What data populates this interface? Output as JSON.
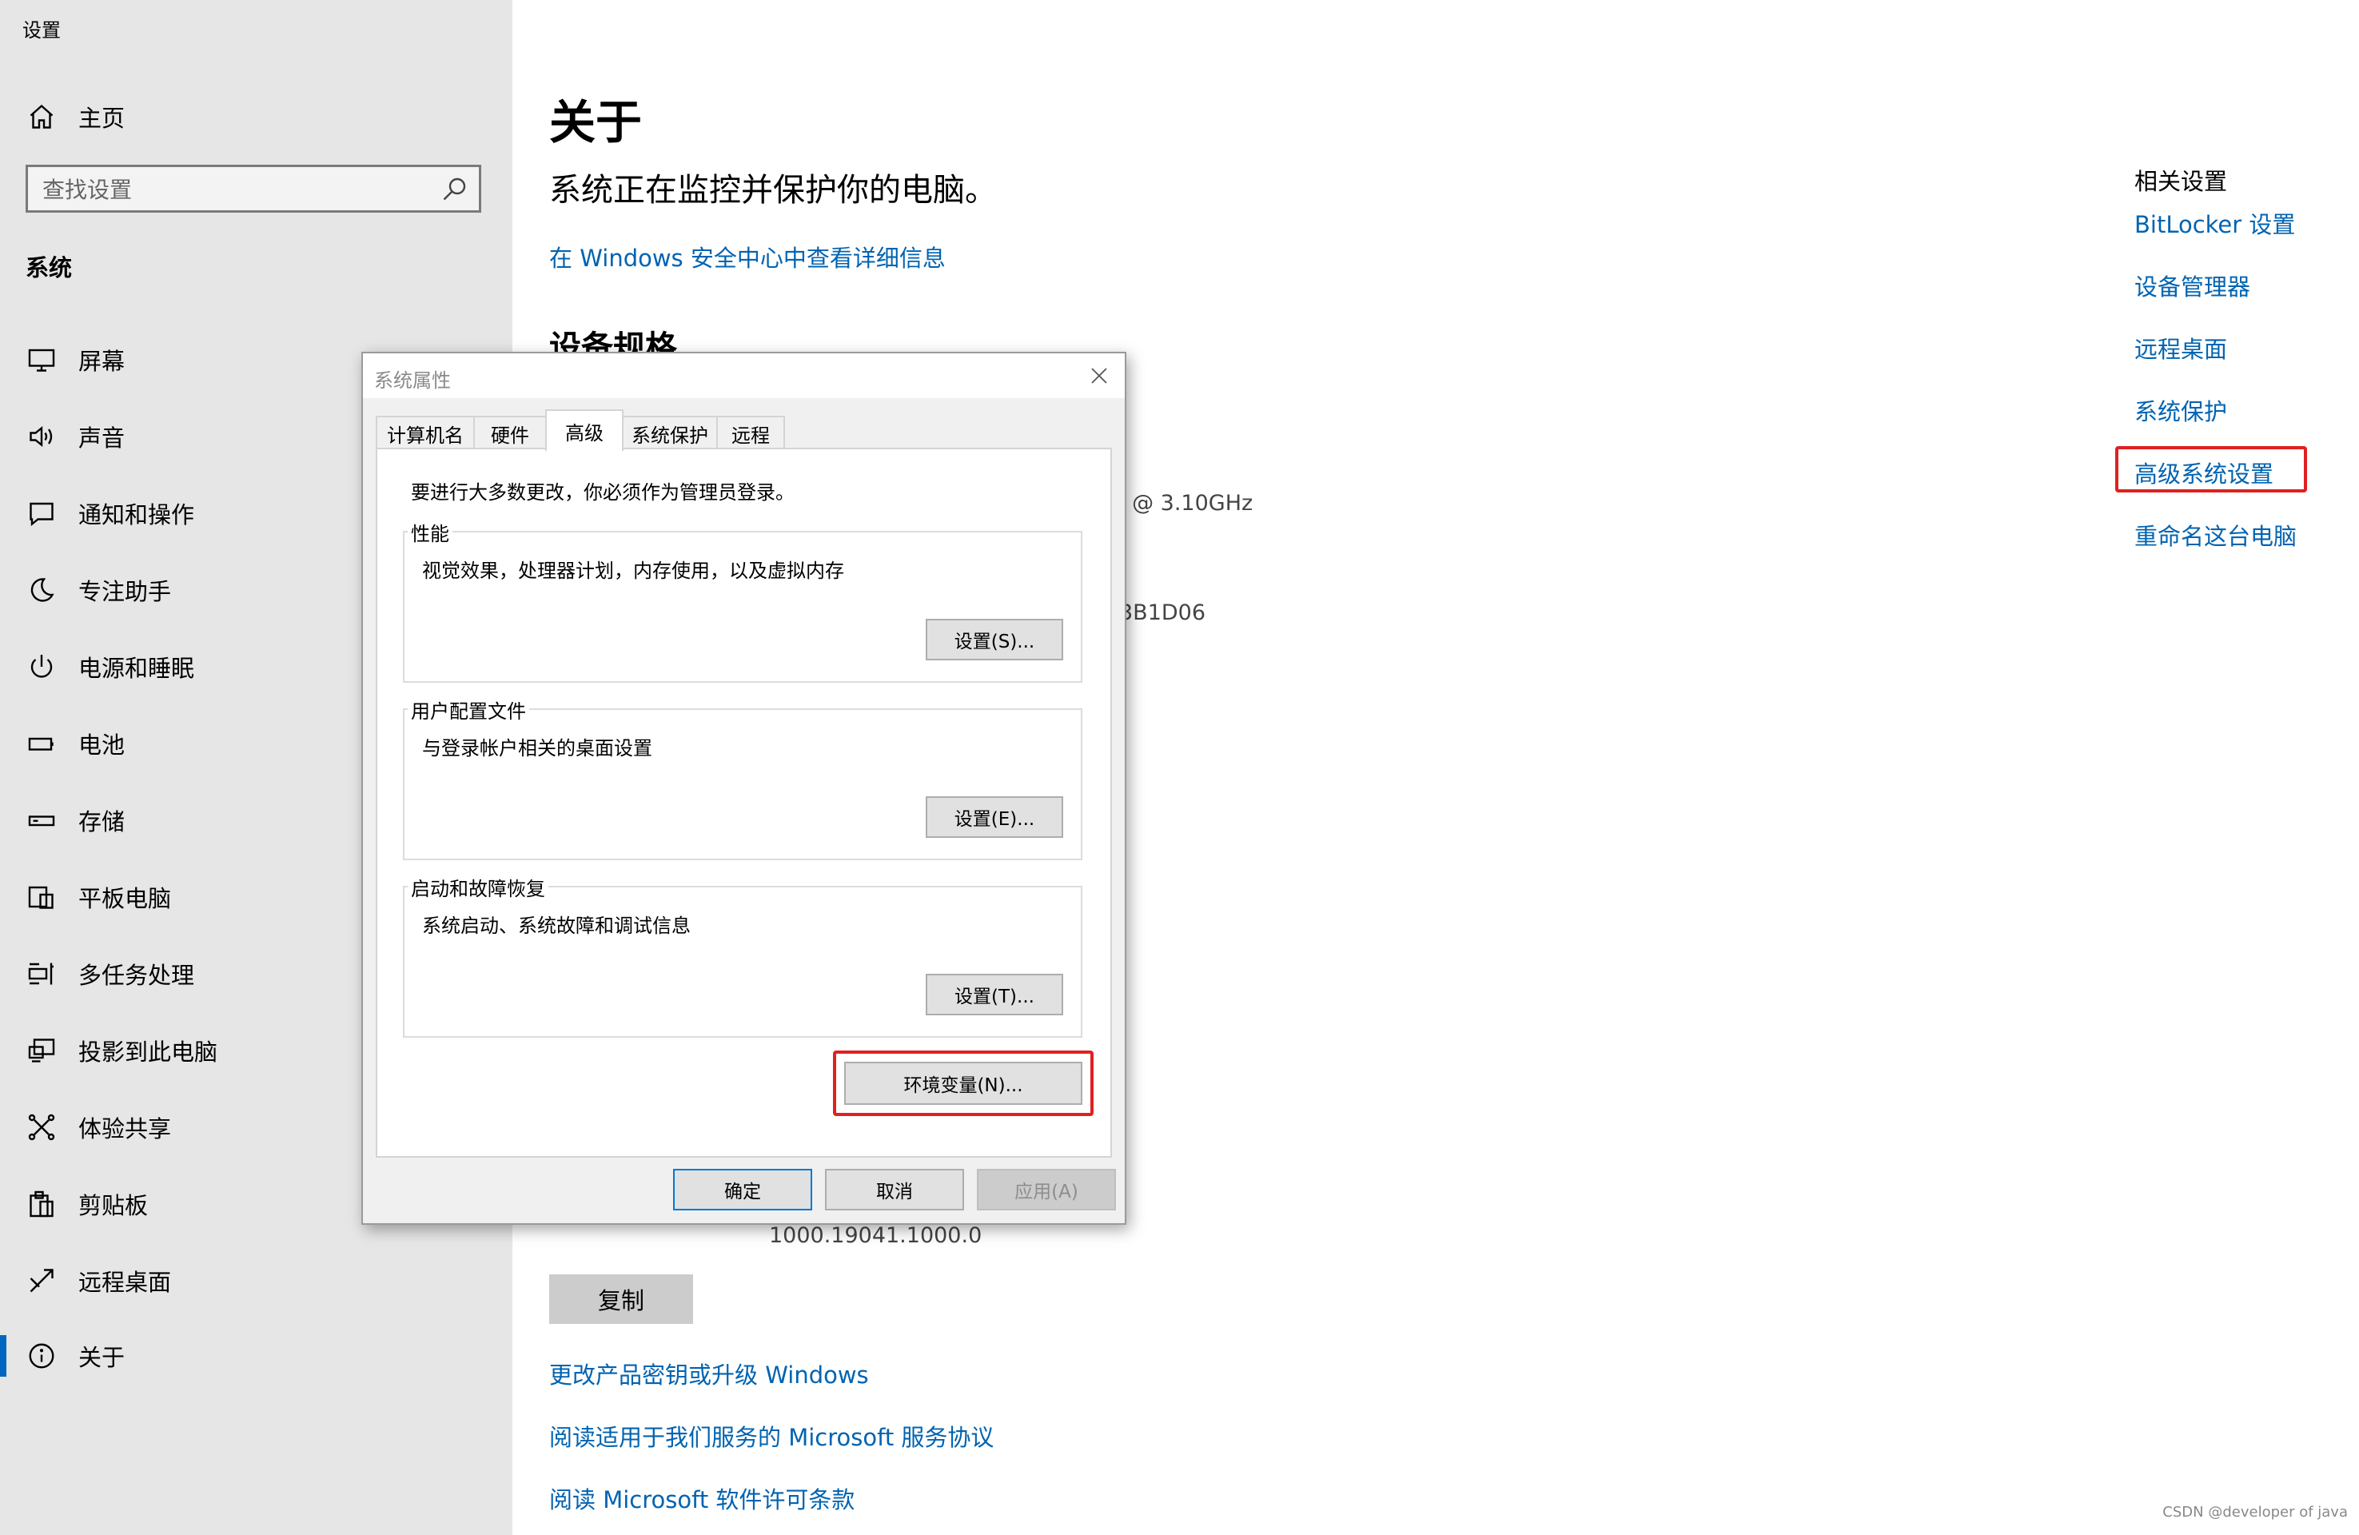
{
  "window": {
    "title": "设置"
  },
  "sidebar": {
    "home_label": "主页",
    "search_placeholder": "查找设置",
    "section_label": "系统",
    "items": [
      {
        "label": "屏幕",
        "icon": "display-icon"
      },
      {
        "label": "声音",
        "icon": "speaker-icon"
      },
      {
        "label": "通知和操作",
        "icon": "notification-icon"
      },
      {
        "label": "专注助手",
        "icon": "moon-icon"
      },
      {
        "label": "电源和睡眠",
        "icon": "power-icon"
      },
      {
        "label": "电池",
        "icon": "battery-icon"
      },
      {
        "label": "存储",
        "icon": "storage-icon"
      },
      {
        "label": "平板电脑",
        "icon": "tablet-icon"
      },
      {
        "label": "多任务处理",
        "icon": "multitask-icon"
      },
      {
        "label": "投影到此电脑",
        "icon": "project-icon"
      },
      {
        "label": "体验共享",
        "icon": "share-icon"
      },
      {
        "label": "剪贴板",
        "icon": "clipboard-icon"
      },
      {
        "label": "远程桌面",
        "icon": "remote-desktop-icon"
      },
      {
        "label": "关于",
        "icon": "info-icon"
      }
    ],
    "selected": "关于"
  },
  "main": {
    "title": "关于",
    "status": "系统正在监控并保护你的电脑。",
    "security_link": "在 Windows 安全中心中查看详细信息",
    "device_specs_title": "设备规格",
    "processor_partial": "l @ 3.10GHz",
    "device_id_partial": "3B1D06",
    "os_build_partial": "1000.19041.1000.0",
    "copy_button": "复制",
    "links": [
      "更改产品密钥或升级 Windows",
      "阅读适用于我们服务的 Microsoft 服务协议",
      "阅读 Microsoft 软件许可条款"
    ]
  },
  "related": {
    "title": "相关设置",
    "links": [
      "BitLocker 设置",
      "设备管理器",
      "远程桌面",
      "系统保护",
      "高级系统设置",
      "重命名这台电脑"
    ],
    "highlighted": "高级系统设置"
  },
  "dialog": {
    "title": "系统属性",
    "tabs": [
      "计算机名",
      "硬件",
      "高级",
      "系统保护",
      "远程"
    ],
    "active_tab": "高级",
    "notice": "要进行大多数更改，你必须作为管理员登录。",
    "groups": [
      {
        "title": "性能",
        "desc": "视觉效果，处理器计划，内存使用，以及虚拟内存",
        "button": "设置(S)..."
      },
      {
        "title": "用户配置文件",
        "desc": "与登录帐户相关的桌面设置",
        "button": "设置(E)..."
      },
      {
        "title": "启动和故障恢复",
        "desc": "系统启动、系统故障和调试信息",
        "button": "设置(T)..."
      }
    ],
    "env_button": "环境变量(N)...",
    "ok": "确定",
    "cancel": "取消",
    "apply": "应用(A)"
  },
  "watermark": "CSDN @developer of java",
  "colors": {
    "accent": "#0063b1",
    "highlight_box": "#e02020",
    "sidebar_bg": "#e6e6e6"
  }
}
